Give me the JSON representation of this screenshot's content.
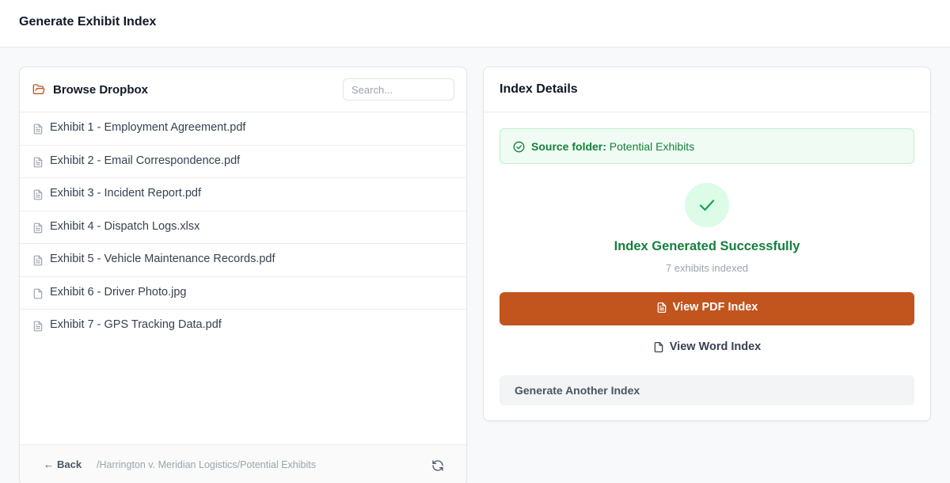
{
  "header": {
    "title": "Generate Exhibit Index"
  },
  "browser": {
    "title": "Browse Dropbox",
    "search_placeholder": "Search...",
    "files": [
      {
        "name": "Exhibit 1 - Employment Agreement.pdf",
        "icon": "file-text-icon"
      },
      {
        "name": "Exhibit 2 - Email Correspondence.pdf",
        "icon": "file-text-icon"
      },
      {
        "name": "Exhibit 3 - Incident Report.pdf",
        "icon": "file-text-icon"
      },
      {
        "name": "Exhibit 4 - Dispatch Logs.xlsx",
        "icon": "file-text-icon"
      },
      {
        "name": "Exhibit 5 - Vehicle Maintenance Records.pdf",
        "icon": "file-text-icon"
      },
      {
        "name": "Exhibit 6 - Driver Photo.jpg",
        "icon": "file-icon"
      },
      {
        "name": "Exhibit 7 - GPS Tracking Data.pdf",
        "icon": "file-text-icon"
      }
    ],
    "footer": {
      "back_arrow": "←",
      "back_label": "Back",
      "path": "/Harrington v. Meridian Logistics/Potential Exhibits"
    }
  },
  "details": {
    "title": "Index Details",
    "source_label": "Source folder:",
    "source_value": "Potential Exhibits",
    "success_title": "Index Generated Successfully",
    "exhibit_count": "7 exhibits indexed",
    "view_pdf_label": "View PDF Index",
    "view_word_label": "View Word Index",
    "generate_another_label": "Generate Another Index"
  },
  "colors": {
    "accent": "#c2541d",
    "success": "#15803d",
    "success_bg": "#effbf3"
  }
}
